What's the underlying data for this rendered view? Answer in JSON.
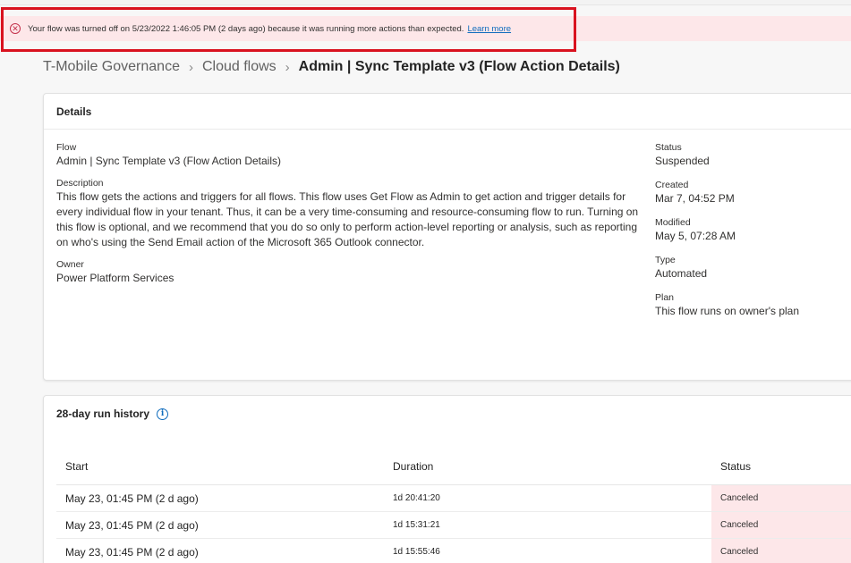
{
  "banner": {
    "message": "Your flow was turned off on 5/23/2022 1:46:05 PM (2 days ago) because it was running more actions than expected.",
    "link": "Learn more",
    "icon": "error-circle-icon",
    "color": "#fde7e9"
  },
  "breadcrumb": {
    "items": [
      "T-Mobile Governance",
      "Cloud flows"
    ],
    "separator": ">",
    "current": "Admin | Sync Template v3 (Flow Action Details)"
  },
  "details": {
    "title": "Details",
    "flow_label": "Flow",
    "flow_value": "Admin | Sync Template v3 (Flow Action Details)",
    "description_label": "Description",
    "description_value": "This flow gets the actions and triggers for all flows. This flow uses Get Flow as Admin to get action and trigger details for every individual flow in your tenant. Thus, it can be a very time-consuming and resource-consuming flow to run. Turning on this flow is optional, and we recommend that you do so only to perform action-level reporting or analysis, such as reporting on who's using the Send Email action of the Microsoft 365 Outlook connector.",
    "owner_label": "Owner",
    "owner_value": "Power Platform Services",
    "status_label": "Status",
    "status_value": "Suspended",
    "created_label": "Created",
    "created_value": "Mar 7, 04:52 PM",
    "modified_label": "Modified",
    "modified_value": "May 5, 07:28 AM",
    "type_label": "Type",
    "type_value": "Automated",
    "plan_label": "Plan",
    "plan_value": "This flow runs on owner's plan"
  },
  "history": {
    "title": "28-day run history",
    "info_icon": "info-icon",
    "columns": {
      "start": "Start",
      "duration": "Duration",
      "status": "Status"
    },
    "rows": [
      {
        "start": "May 23, 01:45 PM (2 d ago)",
        "duration": "1d 20:41:20",
        "status": "Canceled"
      },
      {
        "start": "May 23, 01:45 PM (2 d ago)",
        "duration": "1d 15:31:21",
        "status": "Canceled"
      },
      {
        "start": "May 23, 01:45 PM (2 d ago)",
        "duration": "1d 15:55:46",
        "status": "Canceled"
      }
    ],
    "canceled_color": "#fde7e9"
  },
  "highlight_color": "#d9121f"
}
